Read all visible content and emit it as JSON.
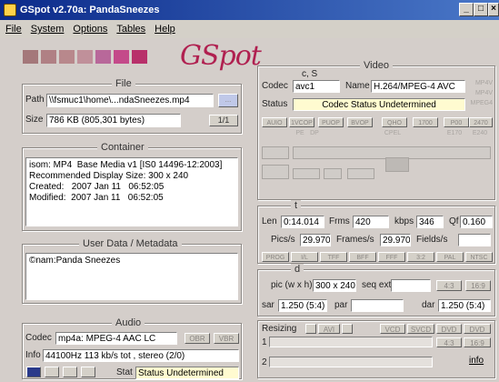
{
  "window": {
    "title": "GSpot v2.70a: PandaSneezes",
    "min": "_",
    "max": "□",
    "close": "×"
  },
  "menu": [
    "File",
    "System",
    "Options",
    "Tables",
    "Help"
  ],
  "logo_text": "GSpot",
  "stripe_colors": [
    "#a4787a",
    "#b08084",
    "#b8888c",
    "#c0909a",
    "#b8689a",
    "#c44a8a",
    "#b8306a"
  ],
  "file": {
    "title": "File",
    "path_label": "Path",
    "path_value": "\\\\fsmuc1\\home\\...ndaSneezes.mp4",
    "browse_label": "...",
    "size_label": "Size",
    "size_value": "786 KB (805,301 bytes)",
    "count_label": "1/1"
  },
  "container": {
    "title": "Container",
    "text": "isom: MP4  Base Media v1 [IS0 14496-12:2003]\nRecommended Display Size: 300 x 240\nCreated:   2007 Jan 11   06:52:05\nModified:  2007 Jan 11   06:52:05"
  },
  "userdata": {
    "title": "User Data / Metadata",
    "text": "©nam:Panda Sneezes"
  },
  "audio": {
    "title": "Audio",
    "codec_label": "Codec",
    "codec_value": "mp4a: MPEG-4 AAC LC",
    "btn1": "OBR",
    "btn2": "VBR",
    "info_label": "Info",
    "info_value": "44100Hz  113 kb/s tot , stereo (2/0)",
    "stat_label": "Stat",
    "stat_value": "Status Undetermined"
  },
  "video": {
    "title": "Video",
    "cs_title": "c, S",
    "codec_label": "Codec",
    "codec_value": "avc1",
    "name_label": "Name",
    "name_value": "H.264/MPEG-4 AVC",
    "status_label": "Status",
    "status_value": "Codec Status Undetermined",
    "side_btns": [
      "MP4V",
      "MP4V",
      "MPEG4"
    ],
    "flag_btns": [
      "AUIO",
      "1VCOP",
      "PUOP",
      "BVOP",
      "QHO",
      "1700",
      "P00",
      "2470"
    ],
    "flag_btns2": [
      "PE",
      "DP",
      "CPEL",
      "E170",
      "E240"
    ]
  },
  "timing": {
    "title": "t",
    "len_label": "Len",
    "len_value": "0:14.014",
    "frms_label": "Frms",
    "frms_value": "420",
    "kbps_label": "kbps",
    "kbps_value": "346",
    "qf_label": "Qf",
    "qf_value": "0.160",
    "pics_label": "Pics/s",
    "pics_value": "29.970",
    "frames_label": "Frames/s",
    "frames_value": "29.970",
    "fields_label": "Fields/s",
    "fields_value": "",
    "btns": [
      "PROG",
      "I/L",
      "TFF",
      "BFF",
      "FFF",
      "3:2",
      "PAL",
      "NTSC"
    ]
  },
  "dims": {
    "title": "d",
    "pic_label": "pic (w x h)",
    "pic_value": "300 x 240",
    "seqext_label": "seq ext",
    "btn1": "4:3",
    "btn2": "16:9",
    "sar_label": "sar",
    "sar_value": "1.250 (5:4)",
    "par_label": "par",
    "par_value": "",
    "dar_label": "dar",
    "dar_value": "1.250 (5:4)"
  },
  "resizing": {
    "label": "Resizing",
    "btns": [
      "AVI",
      "VCD",
      "SVCD",
      "DVD",
      "DVD"
    ],
    "row1_label": "1",
    "row2_label": "2",
    "right_btns": [
      "4:3",
      "16:9"
    ],
    "info_link": "info"
  }
}
